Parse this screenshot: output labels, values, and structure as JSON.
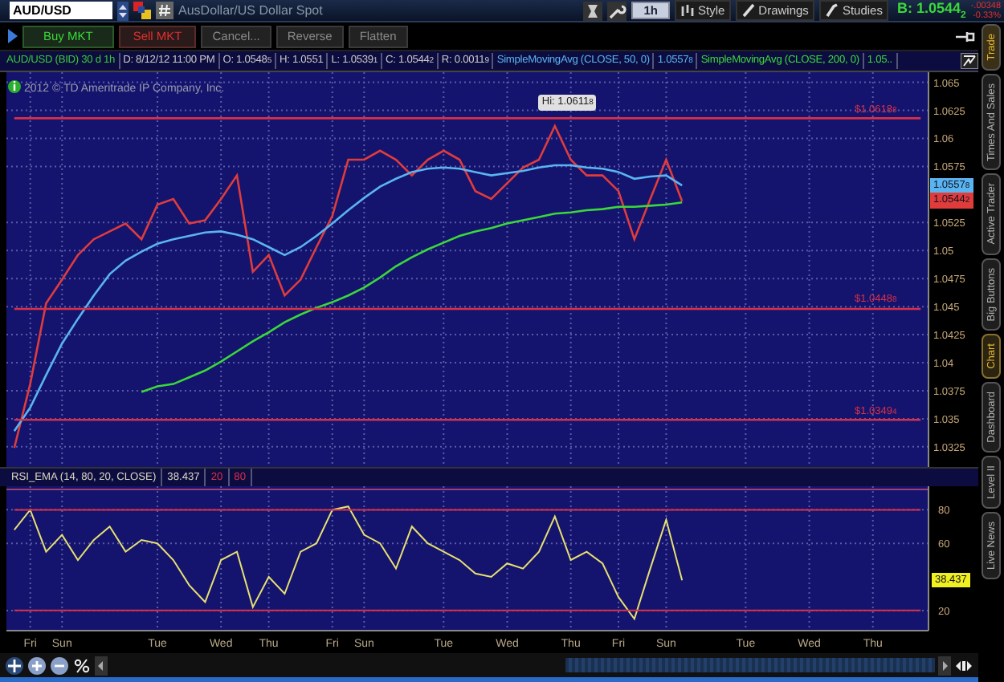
{
  "toolbar": {
    "symbol": "AUD/USD",
    "description": "AusDollar/US Dollar Spot",
    "aggregation": "1h",
    "buttons": [
      "Style",
      "Drawings",
      "Studies"
    ],
    "bid": "B: 1.0544$_{2}$",
    "change": "-.00348",
    "change_percent": "-0.33%"
  },
  "order_buttons": [
    {
      "label": "Buy MKT",
      "kind": "buy"
    },
    {
      "label": "Sell MKT",
      "kind": "sell"
    },
    {
      "label": "Cancel...",
      "kind": "plain"
    },
    {
      "label": "Reverse",
      "kind": "plain"
    },
    {
      "label": "Flatten",
      "kind": "plain"
    }
  ],
  "info_strip": [
    {
      "text": "AUD/USD (BID) 30 d 1h",
      "color": "#39c839"
    },
    {
      "text": "D: 8/12/12 11:00 PM",
      "color": "#c8c8c8"
    },
    {
      "text": "O: 1.0548$_{5}$",
      "color": "#c8c8c8"
    },
    {
      "text": "H: 1.0551",
      "color": "#c8c8c8"
    },
    {
      "text": "L: 1.0539$_{1}$",
      "color": "#c8c8c8"
    },
    {
      "text": "C: 1.0544$_{2}$",
      "color": "#c8c8c8"
    },
    {
      "text": "R: 0.0011$_{9}$",
      "color": "#c8c8c8"
    }
  ],
  "price_chart": {
    "copyright": "2012 © TD Ameritrade IP Company, Inc.",
    "legend_values": [
      "1.0557$_{8}$",
      "1.05.."
    ],
    "badges": [
      {
        "text": "1.0557$_{8}$",
        "color": "#5ab4f0"
      },
      {
        "text": "1.0544$_{2}$",
        "color": "#e03c3c"
      }
    ],
    "chart_data": {
      "type": "line",
      "series": [
        {
          "color": "#e03c3c",
          "values": [
            1.0324,
            1.0381,
            1.0453,
            1.0474,
            1.0496,
            1.051,
            1.0517,
            1.0524,
            1.051,
            1.0541,
            1.0546,
            1.0524,
            1.0527,
            1.0546,
            1.0567,
            1.0481,
            1.0496,
            1.046,
            1.0474,
            1.0503,
            1.0531,
            1.0581,
            1.0581,
            1.0589,
            1.0581,
            1.0567,
            1.0581,
            1.0589,
            1.0581,
            1.0553,
            1.0546,
            1.056,
            1.0574,
            1.0581,
            1.0611,
            1.0581,
            1.0567,
            1.0567,
            1.0553,
            1.051,
            1.0546,
            1.0581,
            1.0544
          ]
        },
        {
          "name": "SimpleMovingAvg (CLOSE, 50, 0)",
          "color": "#5ab4f0",
          "values": [
            1.0339,
            1.036,
            1.0389,
            1.0417,
            1.0439,
            1.046,
            1.0479,
            1.0491,
            1.0499,
            1.0506,
            1.051,
            1.0513,
            1.0516,
            1.0517,
            1.0514,
            1.051,
            1.0503,
            1.0496,
            1.0503,
            1.0513,
            1.0524,
            1.0536,
            1.0547,
            1.0557,
            1.0564,
            1.057,
            1.0573,
            1.0574,
            1.0573,
            1.057,
            1.0567,
            1.0569,
            1.0571,
            1.0574,
            1.0576,
            1.0576,
            1.0574,
            1.0573,
            1.057,
            1.0564,
            1.0566,
            1.0567,
            1.0558
          ]
        },
        {
          "name": "SimpleMovingAvg (CLOSE, 200, 0)",
          "color": "#3ad83a",
          "values": [
            null,
            null,
            null,
            null,
            null,
            null,
            null,
            null,
            1.0374,
            1.0379,
            1.0381,
            1.0387,
            1.0393,
            1.0401,
            1.041,
            1.0419,
            1.0427,
            1.0436,
            1.0443,
            1.0449,
            1.0454,
            1.046,
            1.0467,
            1.0476,
            1.0486,
            1.0494,
            1.0501,
            1.0507,
            1.0513,
            1.0517,
            1.052,
            1.0524,
            1.0527,
            1.053,
            1.0533,
            1.0534,
            1.0536,
            1.0537,
            1.0539,
            1.0539,
            1.054,
            1.0541,
            1.0543
          ]
        },
        {
          "color": "#d83048",
          "values": [
            1.0618,
            1.0618,
            1.0618,
            1.0618,
            1.0618,
            1.0618,
            1.0618,
            1.0618,
            1.0618,
            1.0618,
            1.0618,
            1.0618,
            1.0618,
            1.0618,
            1.0618,
            1.0618,
            1.0618,
            1.0618,
            1.0618,
            1.0618,
            1.0618,
            1.0618,
            1.0618,
            1.0618,
            1.0618,
            1.0618,
            1.0618,
            1.0618,
            1.0618,
            1.0618,
            1.0618,
            1.0618,
            1.0618,
            1.0618,
            1.0618,
            1.0618,
            1.0618,
            1.0618,
            1.0618,
            1.0618,
            1.0618,
            1.0618,
            1.0618,
            1.0618,
            1.0618,
            1.0618,
            1.0618,
            1.0618,
            1.0618,
            1.0618,
            1.0618,
            1.0618,
            1.0618,
            1.0618,
            1.0618,
            1.0618,
            1.0618,
            1.0618
          ]
        },
        {
          "color": "#d83048",
          "values": [
            1.0448,
            1.0448,
            1.0448,
            1.0448,
            1.0448,
            1.0448,
            1.0448,
            1.0448,
            1.0448,
            1.0448,
            1.0448,
            1.0448,
            1.0448,
            1.0448,
            1.0448,
            1.0448,
            1.0448,
            1.0448,
            1.0448,
            1.0448,
            1.0448,
            1.0448,
            1.0448,
            1.0448,
            1.0448,
            1.0448,
            1.0448,
            1.0448,
            1.0448,
            1.0448,
            1.0448,
            1.0448,
            1.0448,
            1.0448,
            1.0448,
            1.0448,
            1.0448,
            1.0448,
            1.0448,
            1.0448,
            1.0448,
            1.0448,
            1.0448,
            1.0448,
            1.0448,
            1.0448,
            1.0448,
            1.0448,
            1.0448,
            1.0448,
            1.0448,
            1.0448,
            1.0448,
            1.0448,
            1.0448,
            1.0448,
            1.0448,
            1.0448
          ]
        },
        {
          "color": "#d83048",
          "values": [
            1.0349,
            1.0349,
            1.0349,
            1.0349,
            1.0349,
            1.0349,
            1.0349,
            1.0349,
            1.0349,
            1.0349,
            1.0349,
            1.0349,
            1.0349,
            1.0349,
            1.0349,
            1.0349,
            1.0349,
            1.0349,
            1.0349,
            1.0349,
            1.0349,
            1.0349,
            1.0349,
            1.0349,
            1.0349,
            1.0349,
            1.0349,
            1.0349,
            1.0349,
            1.0349,
            1.0349,
            1.0349,
            1.0349,
            1.0349,
            1.0349,
            1.0349,
            1.0349,
            1.0349,
            1.0349,
            1.0349,
            1.0349,
            1.0349,
            1.0349,
            1.0349,
            1.0349,
            1.0349,
            1.0349,
            1.0349,
            1.0349,
            1.0349,
            1.0349,
            1.0349,
            1.0349,
            1.0349,
            1.0349,
            1.0349,
            1.0349,
            1.0349
          ]
        }
      ],
      "ylim": [
        1.0307,
        1.0659
      ],
      "yticks": [
        1.065,
        1.0625,
        1.06,
        1.0575,
        1.0525,
        1.05,
        1.0475,
        1.045,
        1.0425,
        1.04,
        1.0375,
        1.035,
        1.0325
      ],
      "grid": true,
      "annotations": [
        "Hi: 1.0611$_{8}$"
      ]
    },
    "level_labels": [
      "$1.0618$_{8}$",
      "$1.0448$_{8}$",
      "$1.0349$_{4}$"
    ]
  },
  "rsi": {
    "value": "38.437",
    "levels": [
      "20",
      "80"
    ],
    "badges": [
      {
        "text": "38.437",
        "color": "#f0f020"
      }
    ],
    "chart_data": {
      "type": "line",
      "categories": [
        null,
        "Fri",
        null,
        "Sun",
        null,
        null,
        null,
        null,
        null,
        "Tue",
        null,
        null,
        null,
        "Wed",
        null,
        null,
        "Thu",
        null,
        null,
        null,
        "Fri",
        null,
        "Sun",
        null,
        null,
        null,
        null,
        "Tue",
        null,
        null,
        null,
        "Wed",
        null,
        null,
        null,
        "Thu",
        null,
        null,
        "Fri",
        null,
        null,
        "Sun",
        null,
        null,
        null,
        null,
        "Tue",
        null,
        null,
        null,
        "Wed",
        null,
        null,
        null,
        "Thu",
        null,
        null,
        null
      ],
      "series": [
        {
          "name": "RSI_EMA (14, 80, 20, CLOSE)",
          "color": "#e8e070",
          "values": [
            68,
            80,
            55,
            65,
            50,
            62,
            70,
            55,
            62,
            60,
            50,
            35,
            25,
            50,
            55,
            22,
            40,
            30,
            55,
            60,
            80,
            82,
            65,
            60,
            45,
            70,
            60,
            55,
            50,
            42,
            40,
            48,
            45,
            55,
            76,
            50,
            55,
            48,
            28,
            15,
            45,
            74,
            38,
            null,
            null,
            null,
            null,
            null,
            null,
            null,
            null,
            null,
            null,
            null,
            null,
            null,
            null,
            null
          ]
        },
        {
          "color": "#d83048",
          "values": [
            80,
            80,
            80,
            80,
            80,
            80,
            80,
            80,
            80,
            80,
            80,
            80,
            80,
            80,
            80,
            80,
            80,
            80,
            80,
            80,
            80,
            80,
            80,
            80,
            80,
            80,
            80,
            80,
            80,
            80,
            80,
            80,
            80,
            80,
            80,
            80,
            80,
            80,
            80,
            80,
            80,
            80,
            80,
            80,
            80,
            80,
            80,
            80,
            80,
            80,
            80,
            80,
            80,
            80,
            80,
            80,
            80,
            80
          ]
        },
        {
          "color": "#d83048",
          "values": [
            20,
            20,
            20,
            20,
            20,
            20,
            20,
            20,
            20,
            20,
            20,
            20,
            20,
            20,
            20,
            20,
            20,
            20,
            20,
            20,
            20,
            20,
            20,
            20,
            20,
            20,
            20,
            20,
            20,
            20,
            20,
            20,
            20,
            20,
            20,
            20,
            20,
            20,
            20,
            20,
            20,
            20,
            20,
            20,
            20,
            20,
            20,
            20,
            20,
            20,
            20,
            20,
            20,
            20,
            20,
            20,
            20,
            20
          ]
        }
      ],
      "ylim": [
        8,
        94
      ],
      "yticks": [
        20,
        60,
        80
      ],
      "grid": true
    }
  },
  "sidebar": {
    "header_tab": "Trade",
    "tabs": [
      {
        "label": "Times And Sales",
        "selected": false
      },
      {
        "label": "Active Trader",
        "selected": false
      },
      {
        "label": "Big Buttons",
        "selected": false
      },
      {
        "label": "Chart",
        "selected": true
      },
      {
        "label": "Dashboard",
        "selected": false
      },
      {
        "label": "Level II",
        "selected": false
      },
      {
        "label": "Live News",
        "selected": false
      }
    ]
  }
}
